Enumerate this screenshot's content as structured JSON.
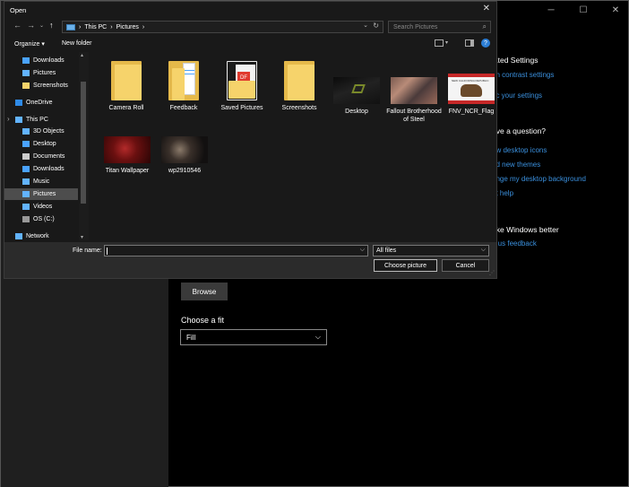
{
  "background": {
    "related_settings": {
      "heading": "lated Settings",
      "links": [
        "gh contrast settings",
        "nc your settings"
      ]
    },
    "question": {
      "heading": "ave a question?",
      "links": [
        "ow desktop icons",
        "nd new themes",
        "ange my desktop background",
        "et help"
      ]
    },
    "better": {
      "heading": "ake Windows better",
      "links": [
        "e us feedback"
      ]
    },
    "browse_label": "Browse",
    "fit_label": "Choose a fit",
    "fit_value": "Fill"
  },
  "dialog": {
    "title": "Open",
    "breadcrumb": [
      "This PC",
      "Pictures"
    ],
    "search_placeholder": "Search Pictures",
    "toolbar": {
      "organize": "Organize",
      "new_folder": "New folder"
    },
    "nav_items": [
      {
        "label": "Downloads",
        "icon": "download-icon",
        "color": "#4aa3ff"
      },
      {
        "label": "Pictures",
        "icon": "pictures-icon",
        "color": "#62b3ff"
      },
      {
        "label": "Screenshots",
        "icon": "folder-icon",
        "color": "#f6d36b"
      },
      {
        "label": "OneDrive",
        "icon": "cloud-icon",
        "color": "#2f8be8"
      },
      {
        "label": "This PC",
        "icon": "computer-icon",
        "color": "#62b3ff"
      },
      {
        "label": "3D Objects",
        "icon": "cube-icon",
        "color": "#62b3ff"
      },
      {
        "label": "Desktop",
        "icon": "desktop-icon",
        "color": "#4aa3ff"
      },
      {
        "label": "Documents",
        "icon": "document-icon",
        "color": "#cccccc"
      },
      {
        "label": "Downloads",
        "icon": "download-icon",
        "color": "#4aa3ff"
      },
      {
        "label": "Music",
        "icon": "music-icon",
        "color": "#62b3ff"
      },
      {
        "label": "Pictures",
        "icon": "pictures-icon",
        "color": "#62b3ff"
      },
      {
        "label": "Videos",
        "icon": "video-icon",
        "color": "#62b3ff"
      },
      {
        "label": "OS (C:)",
        "icon": "drive-icon",
        "color": "#999999"
      },
      {
        "label": "Network",
        "icon": "network-icon",
        "color": "#62b3ff"
      }
    ],
    "files": [
      {
        "label": "Camera Roll",
        "kind": "folder"
      },
      {
        "label": "Feedback",
        "kind": "folder"
      },
      {
        "label": "Saved Pictures",
        "kind": "folder"
      },
      {
        "label": "Screenshots",
        "kind": "folder"
      },
      {
        "label": "Desktop",
        "kind": "image"
      },
      {
        "label": "Fallout Brotherhood of Steel",
        "kind": "image"
      },
      {
        "label": "FNV_NCR_Flag",
        "kind": "image"
      },
      {
        "label": "Titan Wallpaper",
        "kind": "image"
      },
      {
        "label": "wp2910546",
        "kind": "image"
      }
    ],
    "file_name_label": "File name:",
    "file_name_value": "",
    "file_type": "All files",
    "choose_button": "Choose picture",
    "cancel_button": "Cancel",
    "ncr_flag_text": "NEW CALIFORNIA REPUBLIC"
  }
}
